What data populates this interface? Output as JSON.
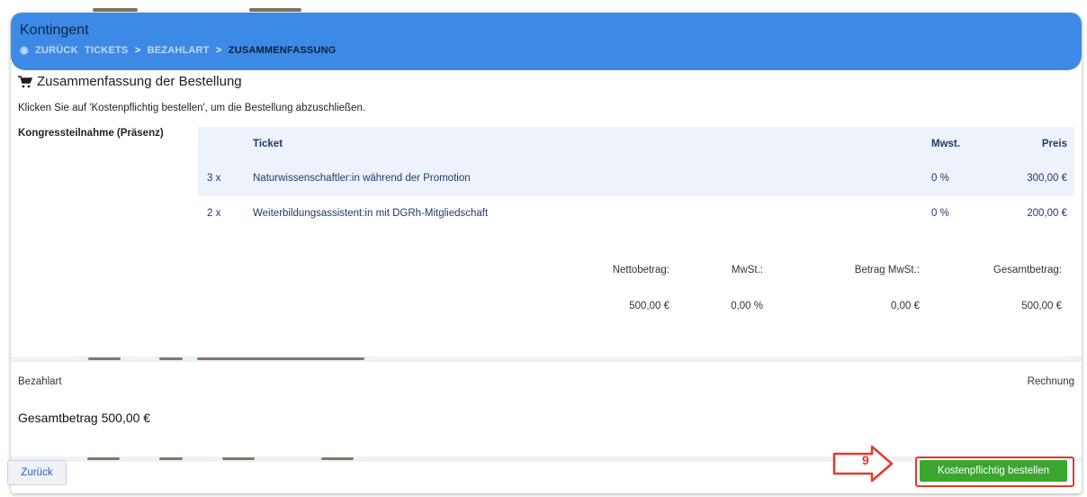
{
  "header": {
    "title": "Kontingent",
    "breadcrumbs": [
      "ZURÜCK",
      "TICKETS",
      "BEZAHLART",
      "ZUSAMMENFASSUNG"
    ],
    "separator": ">"
  },
  "summary": {
    "title": "Zusammenfassung der Bestellung",
    "instruction": "Klicken Sie auf 'Kostenpflichtig bestellen', um die Bestellung abzuschließen.",
    "group_label": "Kongressteilnahme (Präsenz)",
    "columns": {
      "ticket": "Ticket",
      "vat": "Mwst.",
      "price": "Preis"
    },
    "rows": [
      {
        "qty": "3 x",
        "name": "Naturwissenschaftler:in während der Promotion",
        "vat": "0 %",
        "price": "300,00 €"
      },
      {
        "qty": "2 x",
        "name": "Weiterbildungsassistent:in mit DGRh-Mitgliedschaft",
        "vat": "0 %",
        "price": "200,00 €"
      }
    ],
    "totals_labels": {
      "net": "Nettobetrag:",
      "vat": "MwSt.:",
      "vat_amount": "Betrag MwSt.:",
      "total": "Gesamtbetrag:"
    },
    "totals_values": {
      "net": "500,00 €",
      "vat": "0,00 %",
      "vat_amount": "0,00 €",
      "total": "500,00 €"
    }
  },
  "payment": {
    "label": "Bezahlart",
    "value": "Rechnung"
  },
  "grand_total": "Gesamtbetrag 500,00 €",
  "buttons": {
    "back": "Zurück",
    "order": "Kostenpflichtig bestellen"
  },
  "annotation": {
    "step": "9"
  },
  "colors": {
    "header": "#3d8ae6",
    "order_button": "#3aa52f",
    "annotation": "#e23a2a",
    "table_stripe": "#eef3fb"
  }
}
